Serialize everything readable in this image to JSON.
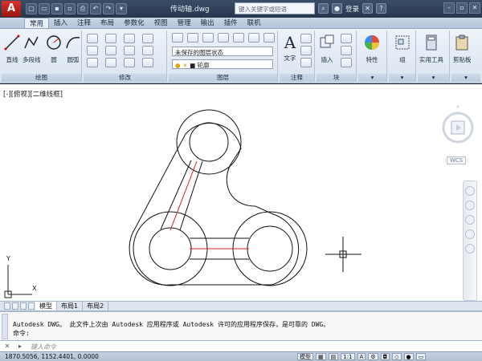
{
  "titlebar": {
    "logo": "A",
    "title": "传动轴.dwg",
    "search_placeholder": "键入关键字或短语",
    "login": "登录"
  },
  "tabs": [
    "常用",
    "插入",
    "注释",
    "布局",
    "参数化",
    "视图",
    "管理",
    "输出",
    "插件",
    "联机"
  ],
  "ribbon": {
    "draw": {
      "label": "绘图",
      "line": "直线",
      "polyline": "多段线",
      "circle": "圆",
      "arc": "圆弧"
    },
    "modify": {
      "label": "修改"
    },
    "layers": {
      "label": "图层",
      "layer_state": "未保存的图层状态",
      "current_layer": "轮廓"
    },
    "annotation": {
      "label": "注释",
      "text": "文字"
    },
    "block": {
      "label": "块",
      "insert": "插入"
    },
    "properties": {
      "label": "特性"
    },
    "groups": {
      "label": "组"
    },
    "utilities": {
      "label": "实用工具"
    },
    "clipboard": {
      "label": "剪贴板"
    }
  },
  "viewport": {
    "label": "[-][俯视][二维线框]",
    "wcs": "WCS",
    "axis_x": "X",
    "axis_y": "Y"
  },
  "layout_tabs": [
    "模型",
    "布局1",
    "布局2"
  ],
  "command": {
    "history_line": "Autodesk DWG。  此文件上次由 Autodesk 应用程序或 Autodesk 许可的应用程序保存，是可靠的 DWG。",
    "prompt_line": "命令:",
    "input_placeholder": "键入命令"
  },
  "status": {
    "coords": "1870.5056, 1152.4401, 0.0000",
    "model": "模型",
    "scale": "1:1"
  }
}
